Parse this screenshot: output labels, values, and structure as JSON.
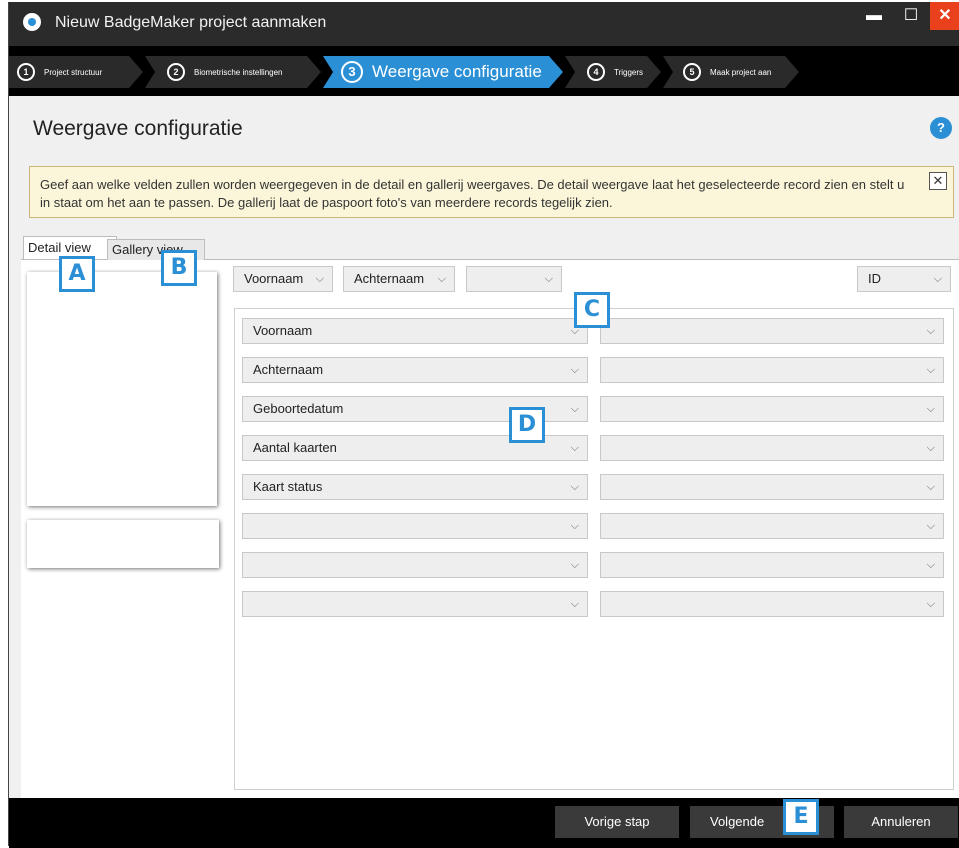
{
  "window": {
    "title": "Nieuw BadgeMaker project aanmaken",
    "controls": {
      "minimize": "▬",
      "maximize": "☐",
      "close": "✕"
    }
  },
  "steps": [
    {
      "num": "1",
      "label": "Project structuur",
      "active": false
    },
    {
      "num": "2",
      "label": "Biometrische instellingen",
      "active": false
    },
    {
      "num": "3",
      "label": "Weergave configuratie",
      "active": true
    },
    {
      "num": "4",
      "label": "Triggers",
      "active": false
    },
    {
      "num": "5",
      "label": "Maak project aan",
      "active": false
    }
  ],
  "page": {
    "title": "Weergave configuratie",
    "help": "?"
  },
  "info": {
    "text": "Geef aan welke velden zullen worden weergegeven in de detail en gallerij weergaves. De detail weergave laat het geselecteerde record zien en stelt u in staat om het aan te passen. De gallerij laat de paspoort foto's van meerdere records tegelijk zien.",
    "close": "✕"
  },
  "tabs": {
    "detail": "Detail view",
    "gallery": "Gallery view"
  },
  "header_selects": [
    {
      "value": "Voornaam"
    },
    {
      "value": "Achternaam"
    },
    {
      "value": ""
    },
    {
      "value": "ID"
    }
  ],
  "field_rows": [
    {
      "left": "Voornaam",
      "right": ""
    },
    {
      "left": "Achternaam",
      "right": ""
    },
    {
      "left": "Geboortedatum",
      "right": ""
    },
    {
      "left": "Aantal kaarten",
      "right": ""
    },
    {
      "left": "Kaart status",
      "right": ""
    },
    {
      "left": "",
      "right": ""
    },
    {
      "left": "",
      "right": ""
    },
    {
      "left": "",
      "right": ""
    }
  ],
  "buttons": {
    "prev": "Vorige stap",
    "next": "Volgende",
    "cancel": "Annuleren"
  },
  "callouts": {
    "a": "A",
    "b": "B",
    "c": "C",
    "d": "D",
    "e": "E"
  },
  "colors": {
    "accent": "#2b8fd6",
    "titlebar": "#2b2b2b",
    "close": "#e8411c",
    "info_bg": "#fbf6d9"
  }
}
